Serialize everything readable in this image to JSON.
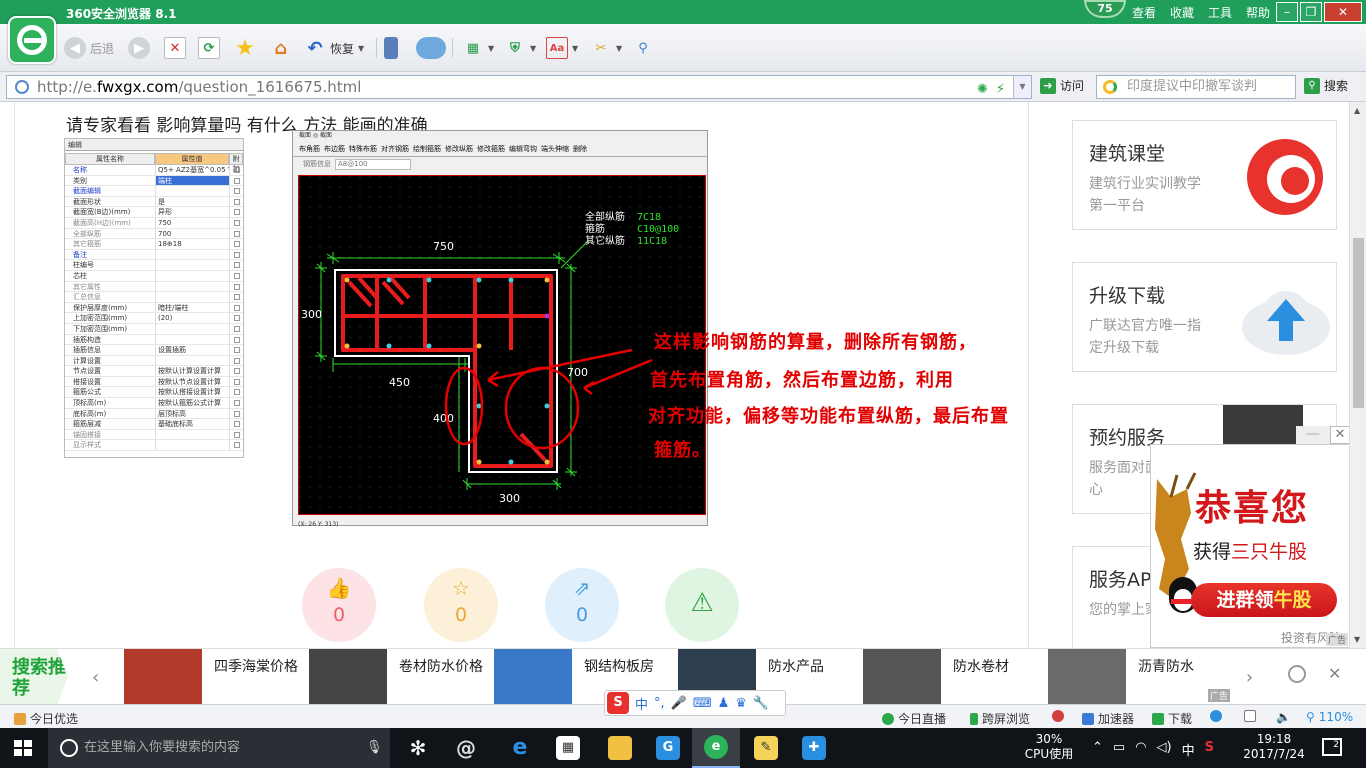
{
  "browser": {
    "title": "360安全浏览器 8.1",
    "score": "75",
    "menus": [
      "查看",
      "收藏",
      "工具",
      "帮助"
    ],
    "toolbar": {
      "back": "后退",
      "restore": "恢复"
    },
    "url_prefix": "http://e.",
    "url_domain": "fwxgx.com",
    "url_path": "/question_1616675.html",
    "visit": "访问",
    "search_placeholder": "印度提议中印撤军谈判",
    "search": "搜索"
  },
  "page": {
    "question": "请专家看看  影响算量吗 有什么 方法 能画的准确",
    "prop_panel": {
      "tab": "编辑",
      "headers": [
        "属性名称",
        "属性值",
        "附加"
      ],
      "rows": [
        {
          "name": "名称",
          "value": "Q5+ AZ2基宽^0.05 YQ3",
          "style": "blue"
        },
        {
          "name": "类别",
          "value": "端柱",
          "style": "sel"
        },
        {
          "name": "截面编辑",
          "value": "",
          "style": "blue"
        },
        {
          "name": "截面形状",
          "value": "是",
          "style": ""
        },
        {
          "name": "截面宽(B边)(mm)",
          "value": "异形",
          "style": ""
        },
        {
          "name": "截面高(H边)(mm)",
          "value": "750",
          "style": "grey"
        },
        {
          "name": "全部纵筋",
          "value": "700",
          "style": "grey"
        },
        {
          "name": "其它箍筋",
          "value": "18⊕18",
          "style": "grey"
        },
        {
          "name": "备注",
          "value": "",
          "style": "blue"
        },
        {
          "name": "柱编号",
          "value": "",
          "style": ""
        },
        {
          "name": "芯柱",
          "value": "",
          "style": ""
        },
        {
          "name": "其它属性",
          "value": "",
          "style": "grey"
        },
        {
          "name": "汇总信息",
          "value": "",
          "style": "grey"
        },
        {
          "name": "保护层厚度(mm)",
          "value": "暗柱/端柱",
          "style": ""
        },
        {
          "name": "上加密范围(mm)",
          "value": "(20)",
          "style": ""
        },
        {
          "name": "下加密范围(mm)",
          "value": "",
          "style": ""
        },
        {
          "name": "插筋构造",
          "value": "",
          "style": ""
        },
        {
          "name": "插筋信息",
          "value": "设置插筋",
          "style": ""
        },
        {
          "name": "计算设置",
          "value": "",
          "style": ""
        },
        {
          "name": "节点设置",
          "value": "按默认计算设置计算",
          "style": ""
        },
        {
          "name": "搭接设置",
          "value": "按默认节点设置计算",
          "style": ""
        },
        {
          "name": "箍筋公式",
          "value": "按默认搭接设置计算",
          "style": ""
        },
        {
          "name": "顶标高(m)",
          "value": "按默认箍筋公式计算",
          "style": ""
        },
        {
          "name": "底标高(m)",
          "value": "层顶标高",
          "style": ""
        },
        {
          "name": "箍筋层减",
          "value": "基础底标高",
          "style": ""
        },
        {
          "name": "锚固搭接",
          "value": "",
          "style": "grey"
        },
        {
          "name": "显示样式",
          "value": "",
          "style": "grey"
        }
      ]
    },
    "cad": {
      "tabs": "截面  ◎  截面",
      "toolbar": [
        "布角筋",
        "布边筋",
        "特殊布筋",
        "对齐钢筋",
        "绘制箍筋",
        "修改纵筋",
        "修改箍筋",
        "编辑弯钩",
        "端头伸缩",
        "删除"
      ],
      "param_label": "钢筋信息",
      "param_value": "A8@100",
      "legend_labels": [
        "全部纵筋",
        "箍筋",
        "其它纵筋"
      ],
      "legend_values": [
        "7C18",
        "C10@100",
        "11C18"
      ],
      "dims": {
        "top": "750",
        "left": "300",
        "mid": "450",
        "right": "700",
        "lower": "400",
        "bottom": "300"
      },
      "status": "(X: 26 Y: 313)"
    },
    "annotation": [
      "这样影响钢筋的算量，删除所有钢筋，",
      "首先布置角筋，然后布置边筋，利用",
      "对齐功能，偏移等功能布置纵筋，最后布置",
      "箍筋。"
    ],
    "actions": [
      {
        "symbol": "👍",
        "count": "0",
        "bg": "#fde3e5",
        "fg": "#ef5d6b"
      },
      {
        "symbol": "☆",
        "count": "0",
        "bg": "#fdf0d8",
        "fg": "#e9a93a"
      },
      {
        "symbol": "⇗",
        "count": "0",
        "bg": "#dff0fc",
        "fg": "#4a9de0"
      },
      {
        "symbol": "⚠",
        "count": "",
        "bg": "#e0f5e1",
        "fg": "#35a548"
      }
    ]
  },
  "sidebar": {
    "cards": [
      {
        "title": "建筑课堂",
        "sub": "建筑行业实训教学第一平台"
      },
      {
        "title": "升级下载",
        "sub": "广联达官方唯一指定升级下载"
      },
      {
        "title": "预约服务",
        "sub": "服务面对面诺心连心"
      },
      {
        "title": "服务AP",
        "sub": "您的掌上家"
      }
    ]
  },
  "popup_ad": {
    "headline": "恭喜您",
    "line_prefix": "获得",
    "line_red": "三只牛股",
    "button_prefix": "进群领",
    "button_highlight": "牛股",
    "footer": "投资有风险",
    "tag": "广告"
  },
  "recommend": {
    "label": "搜索推荐",
    "items": [
      "四季海棠价格",
      "卷材防水价格",
      "钢结构板房",
      "防水产品",
      "防水卷材",
      "沥青防水"
    ],
    "ad": "广告"
  },
  "statusbar": {
    "left": "今日优选",
    "items": [
      "今日直播",
      "跨屏浏览",
      "加速器",
      "下载"
    ],
    "zoom": "110%",
    "ime": "中"
  },
  "taskbar": {
    "search_placeholder": "在这里输入你要搜索的内容",
    "cpu_percent": "30%",
    "cpu_label": "CPU使用",
    "ime": "中",
    "time": "19:18",
    "date": "2017/7/24",
    "notifications": "2"
  },
  "colors": {
    "brand_green": "#1f9f5a",
    "annotation_red": "#e30000"
  }
}
